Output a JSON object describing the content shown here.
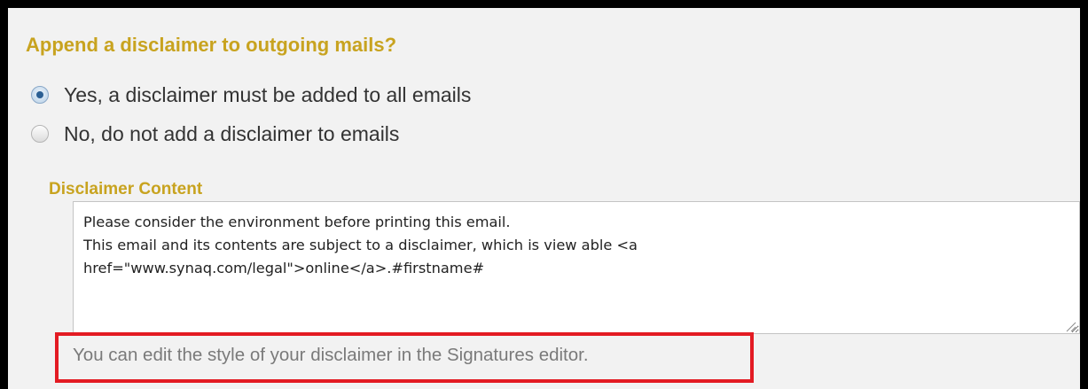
{
  "question": {
    "title": "Append a disclaimer to outgoing mails?"
  },
  "options": [
    {
      "label": "Yes, a disclaimer must be added to all emails",
      "checked": true
    },
    {
      "label": "No, do not add a disclaimer to emails",
      "checked": false
    }
  ],
  "disclaimer": {
    "label": "Disclaimer Content",
    "lines": [
      "Please consider the environment before printing this email.",
      "This email and its contents are subject to a disclaimer, which is view able <a",
      "href=\"www.synaq.com/legal\">online</a>.#firstname#"
    ]
  },
  "helper": {
    "text": "You can edit the style of your disclaimer in the Signatures editor."
  },
  "colors": {
    "heading": "#c8a31f",
    "highlight_border": "#e31b23",
    "panel_background": "#f2f2f2"
  }
}
